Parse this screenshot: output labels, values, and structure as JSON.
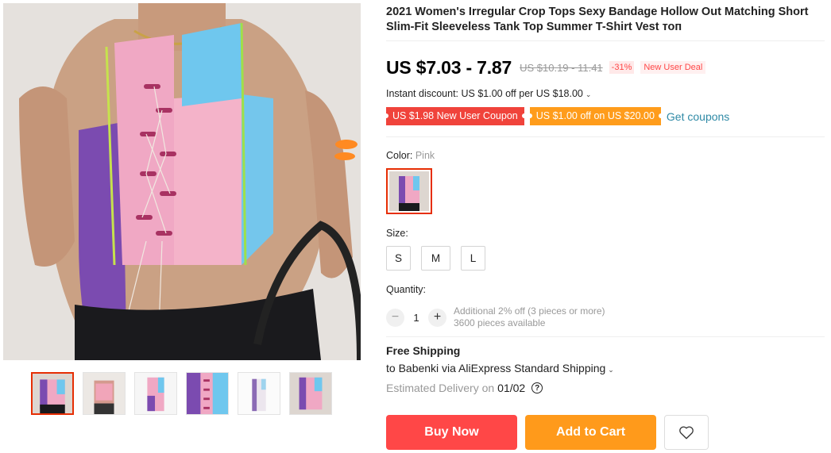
{
  "product": {
    "title": "2021 Women's Irregular Crop Tops Sexy Bandage Hollow Out Matching Short Slim-Fit Sleeveless Tank Top Summer T-Shirt Vest топ"
  },
  "gallery": {
    "thumbnails": [
      "thumb-1",
      "thumb-2",
      "thumb-3",
      "thumb-4",
      "thumb-5",
      "thumb-6"
    ],
    "active_index": 0
  },
  "price": {
    "current": "US $7.03 - 7.87",
    "original": "US $10.19 - 11.41",
    "discount": "-31%",
    "deal": "New User Deal"
  },
  "instant_discount": {
    "text": "Instant discount: US $1.00 off per US $18.00",
    "chevron": "⌄"
  },
  "coupons": {
    "new_user": "US $1.98 New User Coupon",
    "off": "US $1.00 off on US $20.00",
    "get": "Get coupons"
  },
  "color": {
    "label": "Color:",
    "value": "Pink"
  },
  "size": {
    "label": "Size:",
    "options": [
      "S",
      "M",
      "L"
    ]
  },
  "quantity": {
    "label": "Quantity:",
    "minus": "−",
    "value": "1",
    "plus": "+",
    "info_line1": "Additional 2% off (3 pieces or more)",
    "info_line2": "3600 pieces available"
  },
  "shipping": {
    "title": "Free Shipping",
    "to": "to Babenki via AliExpress Standard Shipping",
    "chevron": "⌄",
    "estimated_label": "Estimated Delivery on",
    "estimated_date": "01/02",
    "help": "?"
  },
  "actions": {
    "buy_now": "Buy Now",
    "add_to_cart": "Add to Cart",
    "wishlist_icon": "heart-icon"
  },
  "colors": {
    "accent_red": "#ff4747",
    "accent_orange": "#ff9a1b",
    "link_teal": "#2f8aa6",
    "selected_border": "#e62e04"
  }
}
